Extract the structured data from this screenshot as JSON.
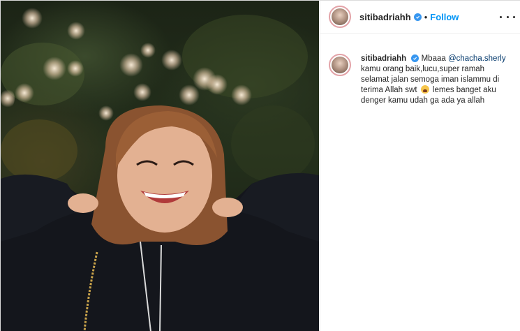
{
  "post": {
    "username": "siti​badriahh",
    "follow_label": "Follow",
    "separator": "•",
    "caption": {
      "username": "siti​badriahh",
      "text_before_mention": "Mbaaa ",
      "mention": "@chacha.sherly",
      "text_line": " kamu orang baik,lucu,super ramah selamat jalan semoga iman islammu di terima Allah swt ",
      "text_after_emoji": " lemes banget aku denger kamu udah ga ada ya allah"
    }
  },
  "icons": [
    "verified-badge-icon",
    "more-options-icon",
    "crying-emoji-icon"
  ],
  "colors": {
    "follow": "#0095f6",
    "verified": "#3897f0",
    "mention": "#00376b"
  }
}
